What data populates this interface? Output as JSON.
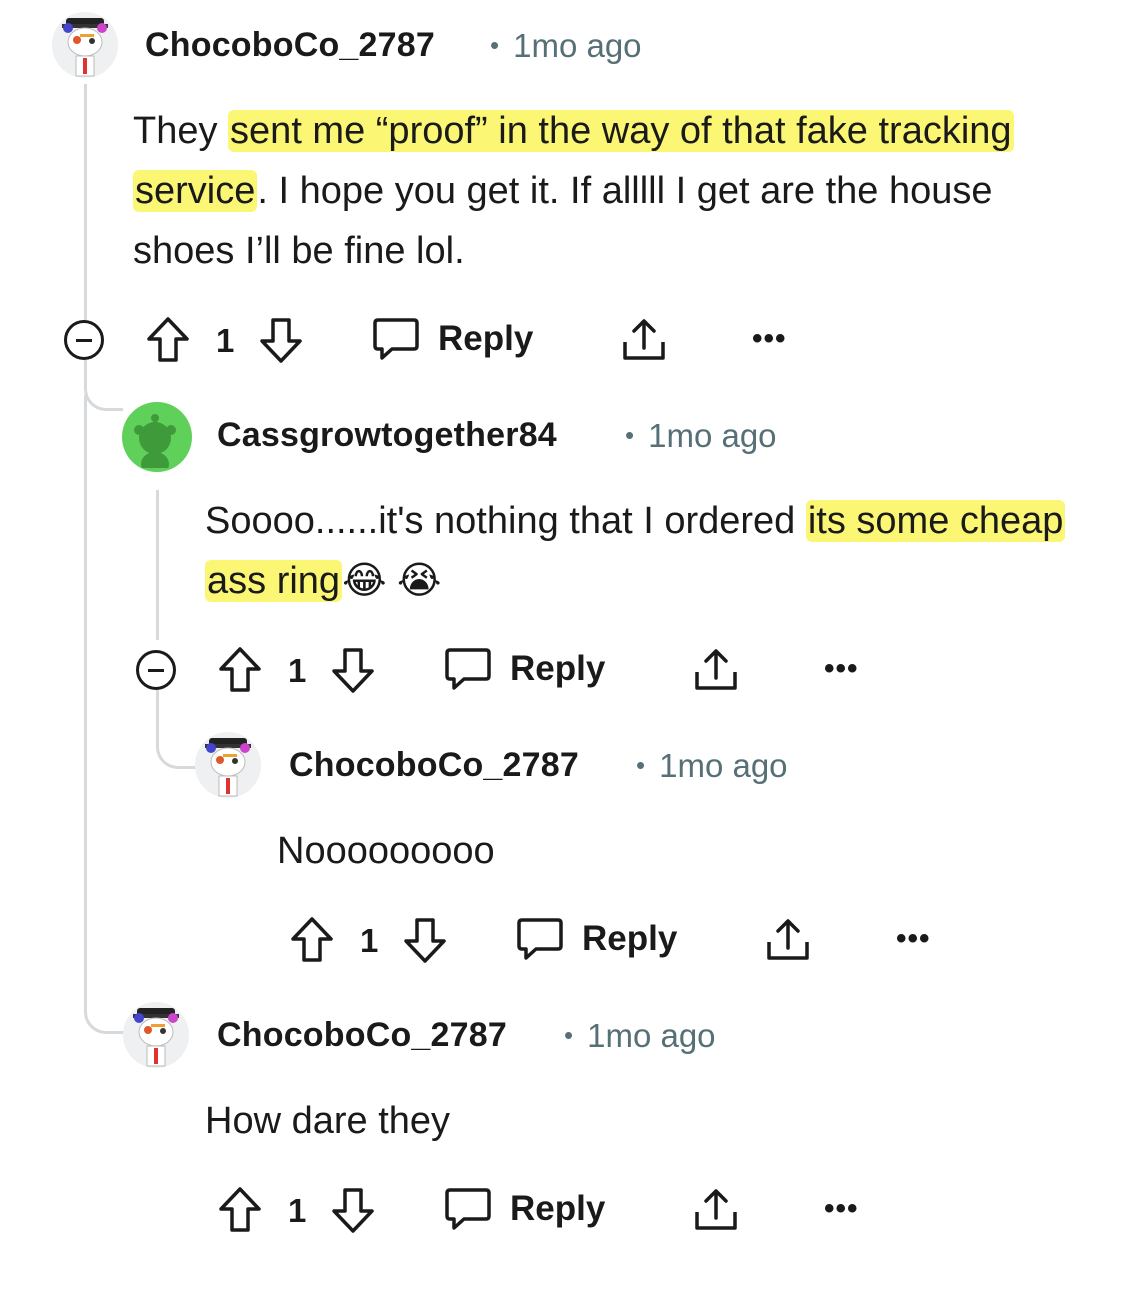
{
  "comments": [
    {
      "username": "ChocoboCo_2787",
      "time": "1mo ago",
      "dot": "•",
      "text_parts": [
        "They ",
        "sent me “proof” in the way of that fake tracking service",
        ". I hope you get it. If alllll I get are the house shoes I’ll be fine lol."
      ],
      "votes": "1",
      "reply_label": "Reply",
      "more": "•••"
    },
    {
      "username": "Cassgrowtogether84",
      "time": "1mo ago",
      "dot": "•",
      "text_parts": [
        "Soooo......it's nothing that I ordered ",
        "its some cheap ass ring",
        "😂 😭"
      ],
      "votes": "1",
      "reply_label": "Reply",
      "more": "•••"
    },
    {
      "username": "ChocoboCo_2787",
      "time": "1mo ago",
      "dot": "•",
      "text": "Nooooooooo",
      "votes": "1",
      "reply_label": "Reply",
      "more": "•••"
    },
    {
      "username": "ChocoboCo_2787",
      "time": "1mo ago",
      "dot": "•",
      "text": "How dare they",
      "votes": "1",
      "reply_label": "Reply",
      "more": "•••"
    }
  ],
  "colors": {
    "highlight": "#fbf774",
    "meta": "#576f76",
    "thread": "#d7dadc",
    "text": "#1a1a1b"
  },
  "icons": [
    "snoo-avatar-icon",
    "upvote-icon",
    "downvote-icon",
    "reply-bubble-icon",
    "share-icon",
    "more-icon",
    "collapse-icon"
  ]
}
